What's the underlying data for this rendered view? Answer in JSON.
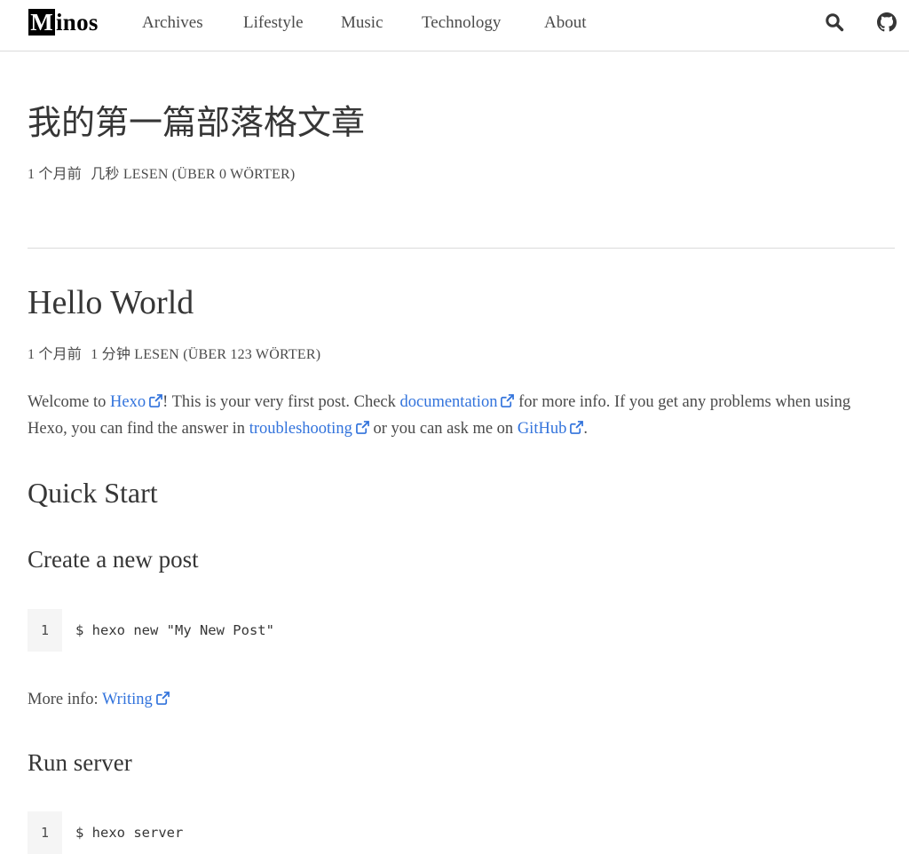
{
  "nav": {
    "logo_initial": "M",
    "logo_rest": "inos",
    "items": [
      "Archives",
      "Lifestyle",
      "Music",
      "Technology",
      "About"
    ],
    "search_icon": "search-icon",
    "github_icon": "github-icon"
  },
  "post1": {
    "title": "我的第一篇部落格文章",
    "meta_date": "1 个月前",
    "meta_reading": "几秒 LESEN (ÜBER 0 WÖRTER)"
  },
  "post2": {
    "title": "Hello World",
    "meta_date": "1 个月前",
    "meta_reading": "1 分钟 LESEN (ÜBER 123 WÖRTER)",
    "intro": {
      "t1": "Welcome to ",
      "link1": "Hexo",
      "t2": "! This is your very first post. Check ",
      "link2": "documentation",
      "t3": " for more info. If you get any problems when using Hexo, you can find the answer in ",
      "link3": "troubleshooting",
      "t4": " or you can ask me on ",
      "link4": "GitHub",
      "t5": "."
    },
    "h_quickstart": "Quick Start",
    "h_create": "Create a new post",
    "code1": {
      "line_no": "1",
      "code": "$ hexo new \"My New Post\""
    },
    "more_info_label": "More info: ",
    "more_info_link": "Writing",
    "h_run": "Run server",
    "code2": {
      "line_no": "1",
      "code": "$ hexo server"
    }
  },
  "colors": {
    "link": "#3273dc",
    "text": "#4a4a4a",
    "heading": "#363636",
    "border": "#dbdbdb"
  }
}
